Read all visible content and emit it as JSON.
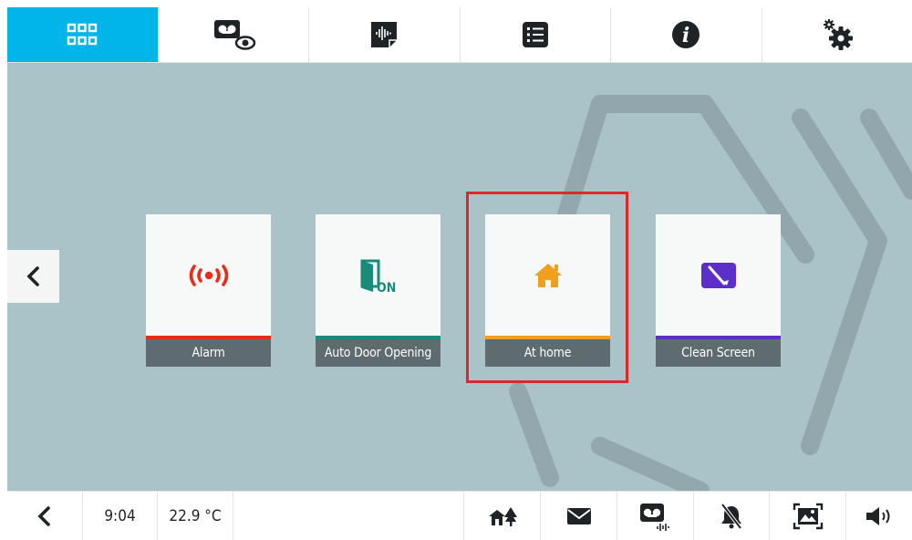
{
  "topbar": {
    "tabs": [
      {
        "icon": "apps-grid-icon",
        "active": true
      },
      {
        "icon": "video-surveillance-icon",
        "active": false
      },
      {
        "icon": "voice-memo-icon",
        "active": false
      },
      {
        "icon": "list-icon",
        "active": false
      },
      {
        "icon": "info-icon",
        "active": false
      },
      {
        "icon": "settings-gear-icon",
        "active": false
      }
    ]
  },
  "main": {
    "tiles": [
      {
        "label": "Alarm",
        "icon": "alarm-broadcast-icon",
        "color": "#e52d1a"
      },
      {
        "label": "Auto Door Opening",
        "icon": "door-on-icon",
        "icon_text": "ON",
        "color": "#1a8a7a"
      },
      {
        "label": "At home",
        "icon": "home-icon",
        "color": "#f29f1f"
      },
      {
        "label": "Clean Screen",
        "icon": "clean-screen-icon",
        "color": "#5c2fc8"
      }
    ],
    "highlight_color": "#e0262b"
  },
  "statusbar": {
    "time": "9:04",
    "temperature": "22.9 °C",
    "icons": [
      "house-tree-icon",
      "envelope-icon",
      "answering-machine-icon",
      "bell-muted-icon",
      "photo-frame-icon",
      "speaker-volume-icon"
    ]
  },
  "colors": {
    "accent": "#00b5ea",
    "background": "#a9c3c9",
    "label_bar": "#5f6c6f"
  }
}
